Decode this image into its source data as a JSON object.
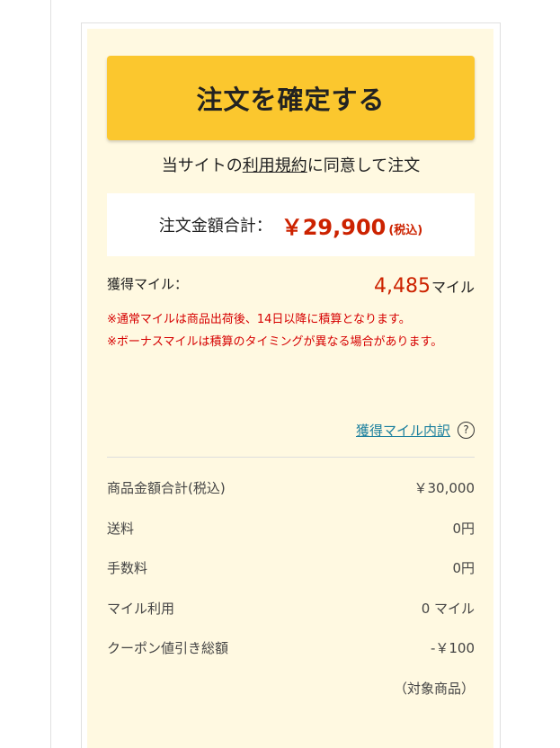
{
  "confirm_button_label": "注文を確定する",
  "agreement": {
    "prefix": "当サイトの",
    "terms_link": "利用規約",
    "suffix": "に同意して注文"
  },
  "total": {
    "label": "注文金額合計：",
    "value": "￥29,900",
    "tax_note": "(税込)"
  },
  "miles": {
    "label": "獲得マイル：",
    "value": "4,485",
    "unit": "マイル",
    "note_1": "※通常マイルは商品出荷後、14日以降に積算となります。",
    "note_2": "※ボーナスマイルは積算のタイミングが異なる場合があります。",
    "breakdown_link": "獲得マイル内訳",
    "help_icon": "?"
  },
  "price_rows": [
    {
      "label": "商品金額合計(税込)",
      "value": "￥30,000"
    },
    {
      "label": "送料",
      "value": "0円"
    },
    {
      "label": "手数料",
      "value": "0円"
    },
    {
      "label": "マイル利用",
      "value": "0 マイル"
    },
    {
      "label": "クーポン値引き総額",
      "value": "-￥100"
    }
  ],
  "coupon_note": "（対象商品）",
  "colors": {
    "button": "#fbc72e",
    "panel_bg": "#fff9e1",
    "price_red": "#cc2200",
    "note_red": "#d60000",
    "link_teal": "#1a7f9e"
  }
}
